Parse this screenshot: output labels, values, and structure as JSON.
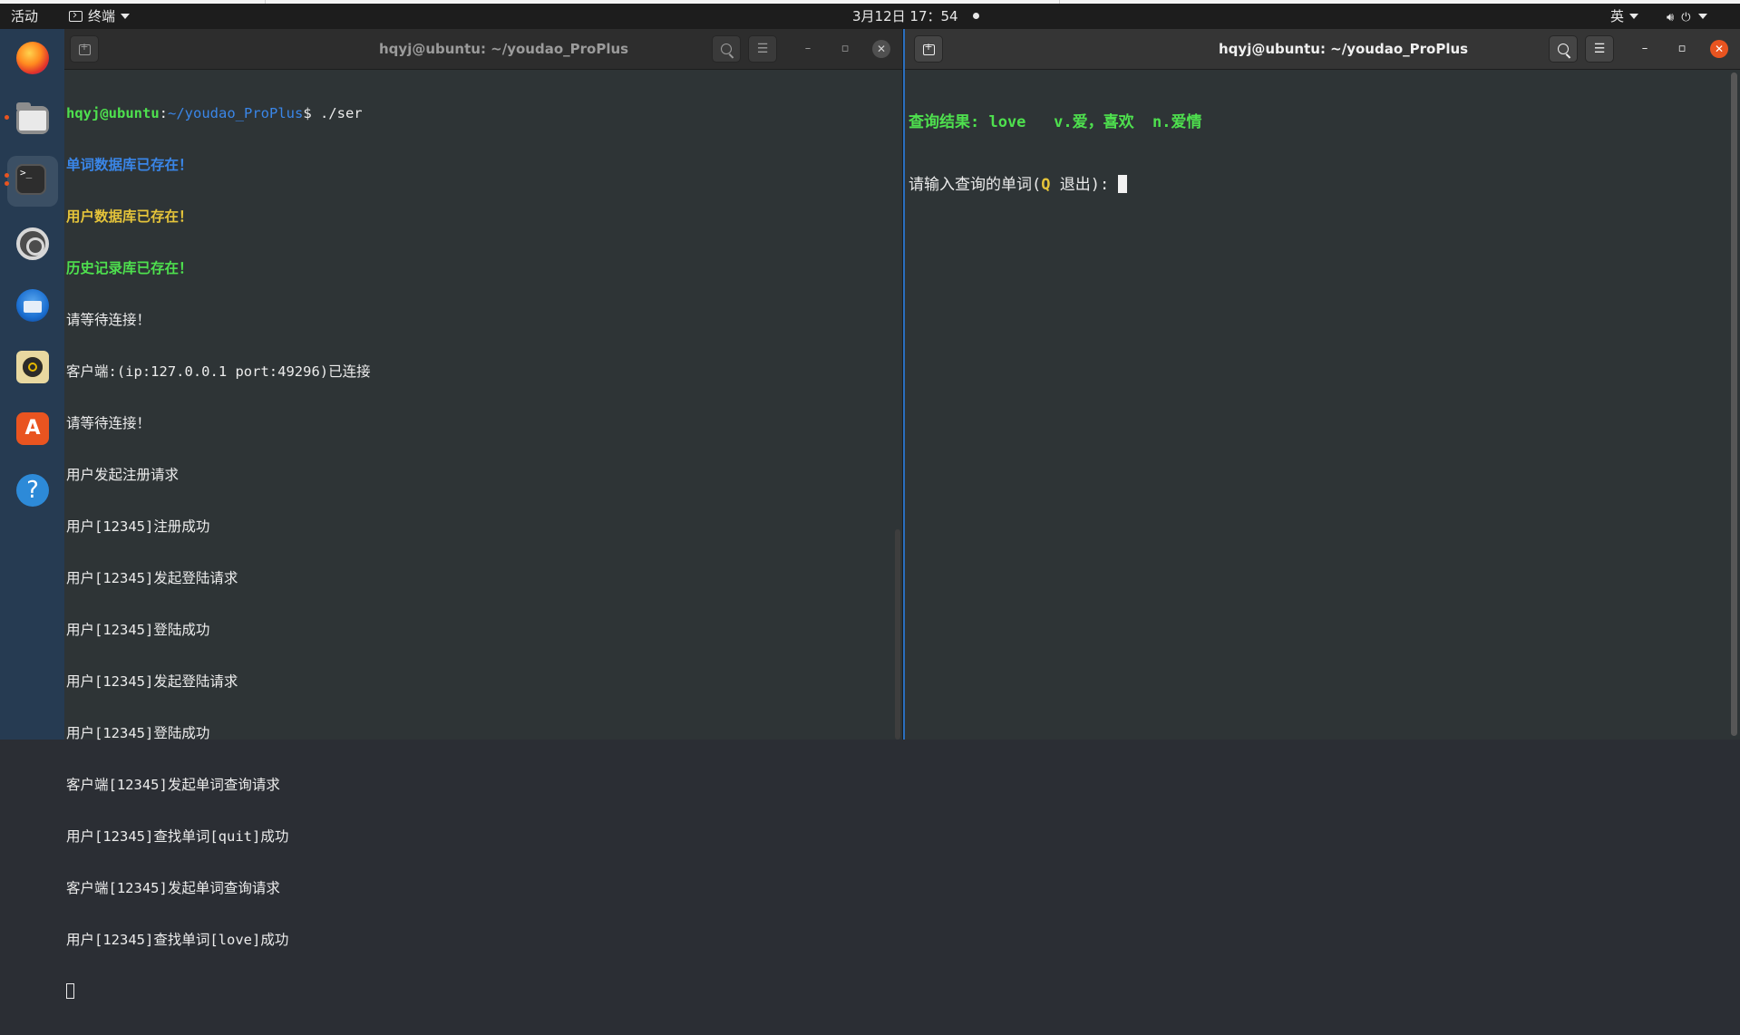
{
  "topbar": {
    "activities": "活动",
    "app_menu": "终端",
    "clock": "3月12日 17：54",
    "input_method": "英",
    "icons": [
      "volume-icon",
      "power-icon",
      "chevron-down-icon"
    ]
  },
  "dock": {
    "items": [
      "Firefox",
      "文件",
      "终端",
      "设置",
      "Thunderbird",
      "Rhythmbox",
      "Ubuntu Software",
      "帮助"
    ]
  },
  "left_terminal": {
    "title": "hqyj@ubuntu: ~/youdao_ProPlus",
    "prompt_user": "hqyj@ubuntu",
    "prompt_path": "~/youdao_ProPlus",
    "prompt_cmd": "$ ./ser",
    "colored_lines": [
      {
        "text": "单词数据库已存在！",
        "color": "blue"
      },
      {
        "text": "用户数据库已存在！",
        "color": "yellow"
      },
      {
        "text": "历史记录库已存在！",
        "color": "green"
      }
    ],
    "lines": [
      "请等待连接！",
      "客户端:(ip:127.0.0.1 port:49296)已连接",
      "请等待连接！",
      "用户发起注册请求",
      "用户[12345]注册成功",
      "用户[12345]发起登陆请求",
      "用户[12345]登陆成功",
      "用户[12345]发起登陆请求",
      "用户[12345]登陆成功",
      "客户端[12345]发起单词查询请求",
      "用户[12345]查找单词[quit]成功",
      "客户端[12345]发起单词查询请求",
      "用户[12345]查找单词[love]成功"
    ]
  },
  "right_terminal": {
    "title": "hqyj@ubuntu: ~/youdao_ProPlus",
    "result_line": "查询结果: love   v.爱，喜欢  n.爱情",
    "input_prefix": "请输入查询的单词(",
    "input_q": "Q",
    "input_suffix": " 退出): "
  },
  "colors": {
    "accent": "#e95420",
    "prompt_green": "#4ee04e",
    "prompt_blue": "#3a86e8",
    "yellow": "#e5c43a",
    "terminal_bg": "#2e3436",
    "dock_bg": "#263b52"
  }
}
